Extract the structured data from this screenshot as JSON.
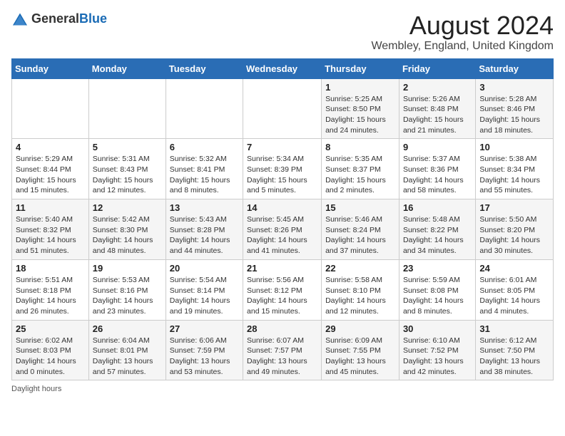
{
  "header": {
    "logo_general": "General",
    "logo_blue": "Blue",
    "title": "August 2024",
    "subtitle": "Wembley, England, United Kingdom"
  },
  "days_of_week": [
    "Sunday",
    "Monday",
    "Tuesday",
    "Wednesday",
    "Thursday",
    "Friday",
    "Saturday"
  ],
  "weeks": [
    [
      {
        "day": "",
        "sunrise": "",
        "sunset": "",
        "daylight": ""
      },
      {
        "day": "",
        "sunrise": "",
        "sunset": "",
        "daylight": ""
      },
      {
        "day": "",
        "sunrise": "",
        "sunset": "",
        "daylight": ""
      },
      {
        "day": "",
        "sunrise": "",
        "sunset": "",
        "daylight": ""
      },
      {
        "day": "1",
        "sunrise": "5:25 AM",
        "sunset": "8:50 PM",
        "daylight": "15 hours and 24 minutes."
      },
      {
        "day": "2",
        "sunrise": "5:26 AM",
        "sunset": "8:48 PM",
        "daylight": "15 hours and 21 minutes."
      },
      {
        "day": "3",
        "sunrise": "5:28 AM",
        "sunset": "8:46 PM",
        "daylight": "15 hours and 18 minutes."
      }
    ],
    [
      {
        "day": "4",
        "sunrise": "5:29 AM",
        "sunset": "8:44 PM",
        "daylight": "15 hours and 15 minutes."
      },
      {
        "day": "5",
        "sunrise": "5:31 AM",
        "sunset": "8:43 PM",
        "daylight": "15 hours and 12 minutes."
      },
      {
        "day": "6",
        "sunrise": "5:32 AM",
        "sunset": "8:41 PM",
        "daylight": "15 hours and 8 minutes."
      },
      {
        "day": "7",
        "sunrise": "5:34 AM",
        "sunset": "8:39 PM",
        "daylight": "15 hours and 5 minutes."
      },
      {
        "day": "8",
        "sunrise": "5:35 AM",
        "sunset": "8:37 PM",
        "daylight": "15 hours and 2 minutes."
      },
      {
        "day": "9",
        "sunrise": "5:37 AM",
        "sunset": "8:36 PM",
        "daylight": "14 hours and 58 minutes."
      },
      {
        "day": "10",
        "sunrise": "5:38 AM",
        "sunset": "8:34 PM",
        "daylight": "14 hours and 55 minutes."
      }
    ],
    [
      {
        "day": "11",
        "sunrise": "5:40 AM",
        "sunset": "8:32 PM",
        "daylight": "14 hours and 51 minutes."
      },
      {
        "day": "12",
        "sunrise": "5:42 AM",
        "sunset": "8:30 PM",
        "daylight": "14 hours and 48 minutes."
      },
      {
        "day": "13",
        "sunrise": "5:43 AM",
        "sunset": "8:28 PM",
        "daylight": "14 hours and 44 minutes."
      },
      {
        "day": "14",
        "sunrise": "5:45 AM",
        "sunset": "8:26 PM",
        "daylight": "14 hours and 41 minutes."
      },
      {
        "day": "15",
        "sunrise": "5:46 AM",
        "sunset": "8:24 PM",
        "daylight": "14 hours and 37 minutes."
      },
      {
        "day": "16",
        "sunrise": "5:48 AM",
        "sunset": "8:22 PM",
        "daylight": "14 hours and 34 minutes."
      },
      {
        "day": "17",
        "sunrise": "5:50 AM",
        "sunset": "8:20 PM",
        "daylight": "14 hours and 30 minutes."
      }
    ],
    [
      {
        "day": "18",
        "sunrise": "5:51 AM",
        "sunset": "8:18 PM",
        "daylight": "14 hours and 26 minutes."
      },
      {
        "day": "19",
        "sunrise": "5:53 AM",
        "sunset": "8:16 PM",
        "daylight": "14 hours and 23 minutes."
      },
      {
        "day": "20",
        "sunrise": "5:54 AM",
        "sunset": "8:14 PM",
        "daylight": "14 hours and 19 minutes."
      },
      {
        "day": "21",
        "sunrise": "5:56 AM",
        "sunset": "8:12 PM",
        "daylight": "14 hours and 15 minutes."
      },
      {
        "day": "22",
        "sunrise": "5:58 AM",
        "sunset": "8:10 PM",
        "daylight": "14 hours and 12 minutes."
      },
      {
        "day": "23",
        "sunrise": "5:59 AM",
        "sunset": "8:08 PM",
        "daylight": "14 hours and 8 minutes."
      },
      {
        "day": "24",
        "sunrise": "6:01 AM",
        "sunset": "8:05 PM",
        "daylight": "14 hours and 4 minutes."
      }
    ],
    [
      {
        "day": "25",
        "sunrise": "6:02 AM",
        "sunset": "8:03 PM",
        "daylight": "14 hours and 0 minutes."
      },
      {
        "day": "26",
        "sunrise": "6:04 AM",
        "sunset": "8:01 PM",
        "daylight": "13 hours and 57 minutes."
      },
      {
        "day": "27",
        "sunrise": "6:06 AM",
        "sunset": "7:59 PM",
        "daylight": "13 hours and 53 minutes."
      },
      {
        "day": "28",
        "sunrise": "6:07 AM",
        "sunset": "7:57 PM",
        "daylight": "13 hours and 49 minutes."
      },
      {
        "day": "29",
        "sunrise": "6:09 AM",
        "sunset": "7:55 PM",
        "daylight": "13 hours and 45 minutes."
      },
      {
        "day": "30",
        "sunrise": "6:10 AM",
        "sunset": "7:52 PM",
        "daylight": "13 hours and 42 minutes."
      },
      {
        "day": "31",
        "sunrise": "6:12 AM",
        "sunset": "7:50 PM",
        "daylight": "13 hours and 38 minutes."
      }
    ]
  ],
  "footer": "Daylight hours"
}
